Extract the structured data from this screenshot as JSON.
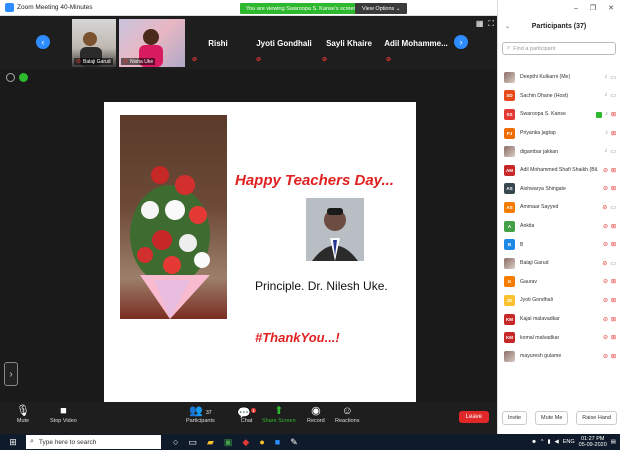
{
  "window": {
    "title": "Zoom Meeting 40-Minutes"
  },
  "banner": {
    "text": "You are viewing Swaroopa S. Kanse's screen",
    "view_options": "View Options"
  },
  "gallery": {
    "tiles": [
      {
        "name": "Balaji Garud",
        "kind": "video"
      },
      {
        "name": "Nisha Uke",
        "kind": "video"
      },
      {
        "name": "Rishi",
        "kind": "name"
      },
      {
        "name": "Jyoti Gondhali",
        "kind": "name"
      },
      {
        "name": "Sayli Khaire",
        "kind": "name"
      },
      {
        "name": "Adil Mohamme...",
        "kind": "name"
      }
    ]
  },
  "slide": {
    "heading": "Happy Teachers Day...",
    "caption": "Principle. Dr. Nilesh Uke.",
    "hashtag": "#ThankYou...!"
  },
  "toolbar": {
    "mute": "Mute",
    "stop_video": "Stop Video",
    "participants": "Participants",
    "participants_count": "37",
    "chat": "Chat",
    "chat_badge": "1",
    "share_screen": "Share Screen",
    "record": "Record",
    "reactions": "Reactions",
    "leave": "Leave"
  },
  "panel": {
    "title": "Participants (37)",
    "search_placeholder": "Find a participant",
    "participants": [
      {
        "name": "Deepthi Kulkarni (Me)",
        "initials": "",
        "color": "#8d6e63",
        "photo": true,
        "mic_off": false,
        "cam_off": false,
        "sharing": false
      },
      {
        "name": "Sachin Dhane (Host)",
        "initials": "SD",
        "color": "#e64a19",
        "photo": false,
        "mic_off": false,
        "cam_off": false,
        "sharing": false
      },
      {
        "name": "Swaroopa S. Kanse",
        "initials": "SS",
        "color": "#e53935",
        "photo": false,
        "mic_off": false,
        "cam_off": true,
        "sharing": true
      },
      {
        "name": "Priyanka jagtap",
        "initials": "PJ",
        "color": "#ef6c00",
        "photo": false,
        "mic_off": false,
        "cam_off": true,
        "sharing": false
      },
      {
        "name": "digambar jakkan",
        "initials": "",
        "color": "#c2185b",
        "photo": true,
        "mic_off": false,
        "cam_off": false,
        "sharing": false
      },
      {
        "name": "Adil Mohammed Shafi Shaikh (Bil...",
        "initials": "AM",
        "color": "#c62828",
        "photo": false,
        "mic_off": true,
        "cam_off": true,
        "sharing": false
      },
      {
        "name": "Aishwarya Shingate",
        "initials": "AS",
        "color": "#37474f",
        "photo": false,
        "mic_off": true,
        "cam_off": true,
        "sharing": false
      },
      {
        "name": "Ammaar Sayyed",
        "initials": "AS",
        "color": "#f57c00",
        "photo": false,
        "mic_off": true,
        "cam_off": false,
        "sharing": false
      },
      {
        "name": "Ankita",
        "initials": "A",
        "color": "#43a047",
        "photo": false,
        "mic_off": true,
        "cam_off": true,
        "sharing": false
      },
      {
        "name": "B",
        "initials": "B",
        "color": "#1e88e5",
        "photo": false,
        "mic_off": true,
        "cam_off": true,
        "sharing": false
      },
      {
        "name": "Balaji Garud",
        "initials": "",
        "color": "#6d4c41",
        "photo": true,
        "mic_off": true,
        "cam_off": false,
        "sharing": false
      },
      {
        "name": "Gaurav",
        "initials": "G",
        "color": "#f57c00",
        "photo": false,
        "mic_off": true,
        "cam_off": true,
        "sharing": false
      },
      {
        "name": "Jyoti Gondhali",
        "initials": "JG",
        "color": "#fbc02d",
        "photo": false,
        "mic_off": true,
        "cam_off": true,
        "sharing": false
      },
      {
        "name": "Kajal malavadkar",
        "initials": "KM",
        "color": "#c62828",
        "photo": false,
        "mic_off": true,
        "cam_off": true,
        "sharing": false
      },
      {
        "name": "komal malvadkar",
        "initials": "KM",
        "color": "#c62828",
        "photo": false,
        "mic_off": true,
        "cam_off": true,
        "sharing": false
      },
      {
        "name": "mayuresh gulame",
        "initials": "",
        "color": "#ad1457",
        "photo": true,
        "mic_off": true,
        "cam_off": true,
        "sharing": false
      }
    ],
    "invite": "Invite",
    "mute_me": "Mute Me",
    "raise_hand": "Raise Hand"
  },
  "taskbar": {
    "search_placeholder": "Type here to search",
    "language": "ENG",
    "time": "01:27 PM",
    "date": "05-09-2020"
  }
}
